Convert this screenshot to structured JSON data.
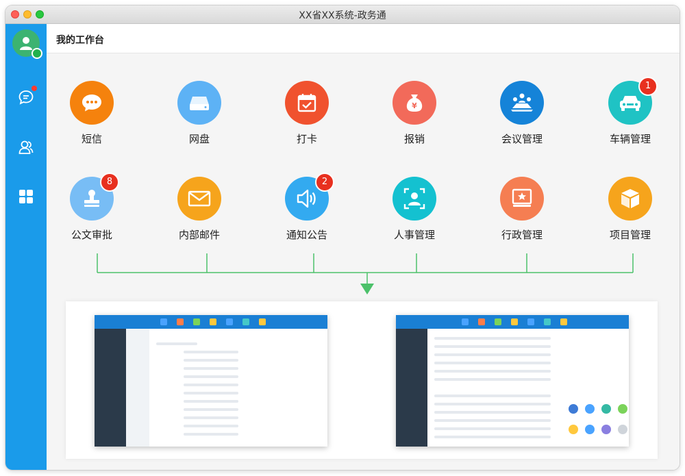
{
  "window": {
    "title": "XX省XX系统-政务通"
  },
  "header": {
    "title": "我的工作台"
  },
  "sidebar": {
    "items": [
      {
        "name": "messages",
        "icon": "chat-icon",
        "has_dot": true
      },
      {
        "name": "contacts",
        "icon": "contacts-icon"
      },
      {
        "name": "apps",
        "icon": "grid-icon"
      }
    ]
  },
  "apps": [
    {
      "label": "短信",
      "icon": "chat-bubble-icon",
      "color": "#f5820d"
    },
    {
      "label": "网盘",
      "icon": "drive-icon",
      "color": "#5db2f5"
    },
    {
      "label": "打卡",
      "icon": "calendar-check-icon",
      "color": "#f0522e"
    },
    {
      "label": "报销",
      "icon": "money-bag-icon",
      "color": "#f26a5a"
    },
    {
      "label": "会议管理",
      "icon": "meeting-icon",
      "color": "#1583d8"
    },
    {
      "label": "车辆管理",
      "icon": "car-icon",
      "color": "#1fc3c4",
      "badge": "1"
    },
    {
      "label": "公文审批",
      "icon": "stamp-icon",
      "color": "#78bdf5",
      "badge": "8"
    },
    {
      "label": "内部邮件",
      "icon": "mail-icon",
      "color": "#f6a41c"
    },
    {
      "label": "通知公告",
      "icon": "speaker-icon",
      "color": "#33aaf0",
      "badge": "2"
    },
    {
      "label": "人事管理",
      "icon": "person-frame-icon",
      "color": "#14c1d0"
    },
    {
      "label": "行政管理",
      "icon": "certificate-icon",
      "color": "#f57e52"
    },
    {
      "label": "项目管理",
      "icon": "box-icon",
      "color": "#f6a41c"
    }
  ],
  "colors": {
    "sidebar": "#1a9bea",
    "connector": "#4cc16a",
    "badge": "#e8301f"
  },
  "previews": [
    {
      "name": "form-screenshot"
    },
    {
      "name": "dashboard-screenshot"
    }
  ]
}
